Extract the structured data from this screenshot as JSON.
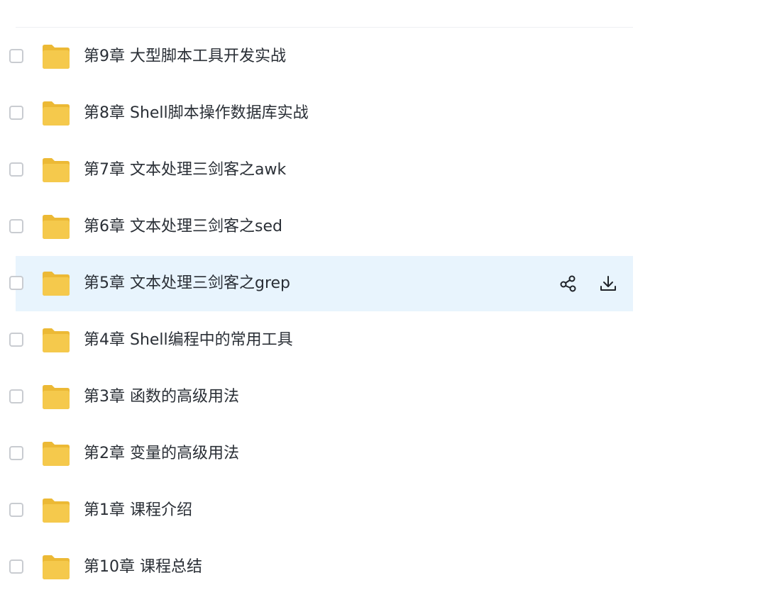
{
  "files": [
    {
      "name": "第9章 大型脚本工具开发实战",
      "icon": "folder-icon"
    },
    {
      "name": "第8章 Shell脚本操作数据库实战",
      "icon": "folder-icon"
    },
    {
      "name": "第7章 文本处理三剑客之awk",
      "icon": "folder-icon"
    },
    {
      "name": "第6章 文本处理三剑客之sed",
      "icon": "folder-icon"
    },
    {
      "name": "第5章 文本处理三剑客之grep",
      "icon": "folder-icon",
      "hovered": true
    },
    {
      "name": "第4章 Shell编程中的常用工具",
      "icon": "folder-icon"
    },
    {
      "name": "第3章 函数的高级用法",
      "icon": "folder-icon"
    },
    {
      "name": "第2章 变量的高级用法",
      "icon": "folder-icon"
    },
    {
      "name": "第1章 课程介绍",
      "icon": "folder-icon"
    },
    {
      "name": "第10章 课程总结",
      "icon": "folder-icon"
    }
  ],
  "row_actions": [
    "share-icon",
    "download-icon"
  ],
  "colors": {
    "folder": "#f5c94c",
    "folder_tab": "#ecb935",
    "hover_bg": "#e8f4fd",
    "text": "#2a2f36"
  }
}
